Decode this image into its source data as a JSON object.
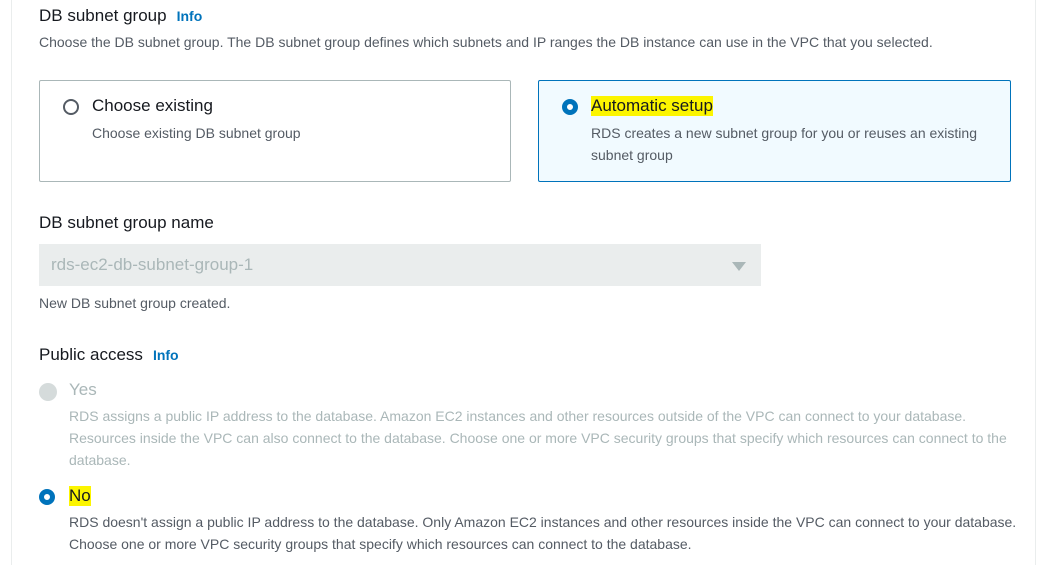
{
  "subnet_group": {
    "label": "DB subnet group",
    "info": "Info",
    "description": "Choose the DB subnet group. The DB subnet group defines which subnets and IP ranges the DB instance can use in the VPC that you selected.",
    "options": [
      {
        "title": "Choose existing",
        "description": "Choose existing DB subnet group",
        "selected": false
      },
      {
        "title": "Automatic setup",
        "description": "RDS creates a new subnet group for you or reuses an existing subnet group",
        "selected": true
      }
    ]
  },
  "subnet_group_name": {
    "label": "DB subnet group name",
    "value": "rds-ec2-db-subnet-group-1",
    "helper": "New DB subnet group created."
  },
  "public_access": {
    "label": "Public access",
    "info": "Info",
    "options": [
      {
        "title": "Yes",
        "description": "RDS assigns a public IP address to the database. Amazon EC2 instances and other resources outside of the VPC can connect to your database. Resources inside the VPC can also connect to the database. Choose one or more VPC security groups that specify which resources can connect to the database.",
        "disabled": true,
        "selected": false
      },
      {
        "title": "No",
        "description": "RDS doesn't assign a public IP address to the database. Only Amazon EC2 instances and other resources inside the VPC can connect to your database. Choose one or more VPC security groups that specify which resources can connect to the database.",
        "disabled": false,
        "selected": true
      }
    ]
  },
  "colors": {
    "accent": "#0073bb",
    "highlight": "#fcf500",
    "disabled": "#aab7b8"
  }
}
